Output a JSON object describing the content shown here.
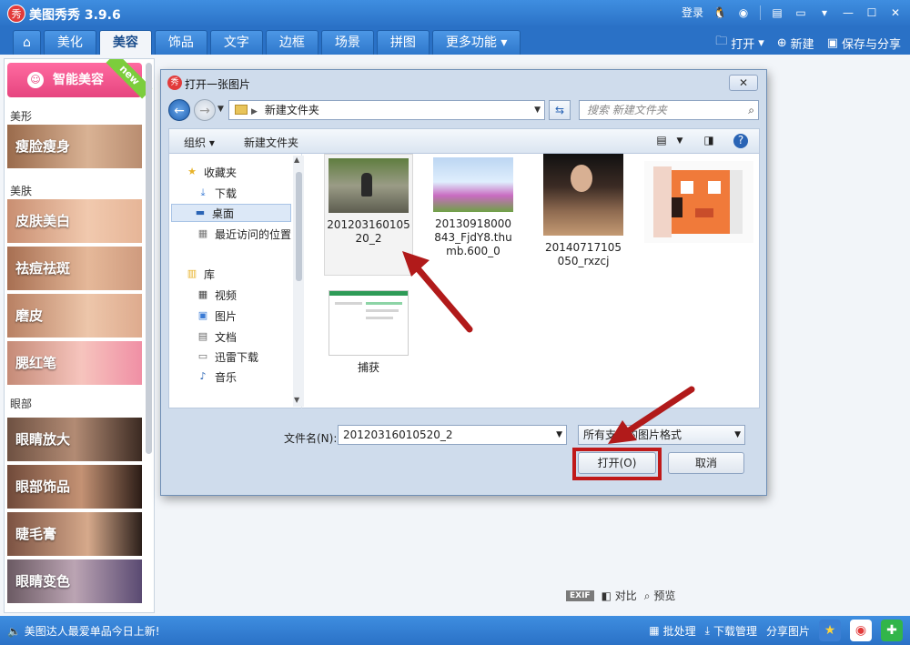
{
  "app": {
    "title": "美图秀秀 3.9.6",
    "logo_char": "秀",
    "login": "登录"
  },
  "menu": {
    "tabs": [
      "美化",
      "美容",
      "饰品",
      "文字",
      "边框",
      "场景",
      "拼图",
      "更多功能 ▾"
    ],
    "active_tab": "美容",
    "open": "打开",
    "new": "新建",
    "save_share": "保存与分享"
  },
  "sidebar": {
    "smart_beauty": "智能美容",
    "new_badge": "new",
    "sections": {
      "shape": "美形",
      "skin": "美肤",
      "eyes": "眼部"
    },
    "features": [
      "瘦脸瘦身",
      "皮肤美白",
      "祛痘祛斑",
      "磨皮",
      "腮红笔",
      "眼睛放大",
      "眼部饰品",
      "睫毛膏",
      "眼睛变色"
    ]
  },
  "bottom_tools": {
    "exif": "EXIF",
    "compare": "对比",
    "preview": "预览"
  },
  "status": {
    "message": "美图达人最爱单品今日上新!",
    "batch": "批处理",
    "download_manager": "下载管理",
    "share_photo": "分享图片"
  },
  "dialog": {
    "title": "打开一张图片",
    "address": "新建文件夹",
    "search_placeholder": "搜索 新建文件夹",
    "organize": "组织 ▾",
    "new_folder": "新建文件夹",
    "nav": {
      "favorites": "收藏夹",
      "downloads": "下载",
      "desktop": "桌面",
      "recent": "最近访问的位置",
      "library": "库",
      "videos": "视频",
      "pictures": "图片",
      "documents": "文档",
      "thunder": "迅雷下载",
      "music": "音乐"
    },
    "files": [
      {
        "name": "20120316010520_2"
      },
      {
        "name": "20130918000843_FjdY8.thumb.600_0"
      },
      {
        "name": "20140717105050_rxzcj"
      },
      {
        "name": ""
      },
      {
        "name": "捕获"
      }
    ],
    "filename_label": "文件名(N):",
    "filename_value": "20120316010520_2",
    "filetype": "所有支持的图片格式",
    "open_button": "打开(O)",
    "cancel_button": "取消"
  },
  "colors": {
    "titlebar": "#2a71c6",
    "highlight": "#c01919",
    "arrow": "#b11a1a",
    "smart_button": "#e6457f"
  }
}
